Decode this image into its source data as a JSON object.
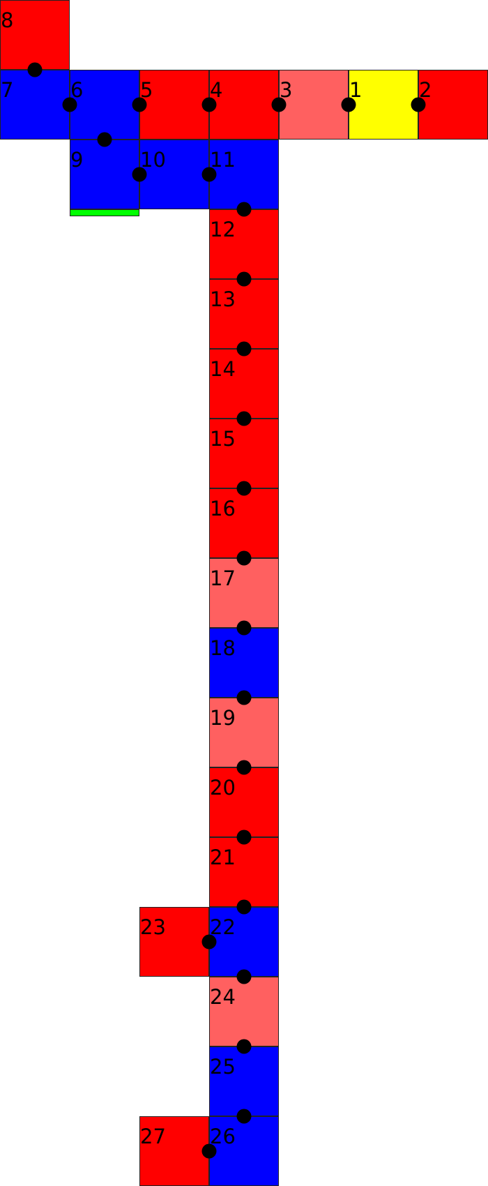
{
  "colors": {
    "red": "#ff0000",
    "salmon": "#ff6060",
    "yellow": "#ffff00",
    "blue": "#0000ff",
    "green": "#00ff00",
    "dot": "#000000",
    "border": "#222222"
  },
  "tiles": [
    {
      "label": "1",
      "color": "yellow"
    },
    {
      "label": "2",
      "color": "red"
    },
    {
      "label": "3",
      "color": "salmon"
    },
    {
      "label": "4",
      "color": "red"
    },
    {
      "label": "5",
      "color": "red"
    },
    {
      "label": "6",
      "color": "blue"
    },
    {
      "label": "7",
      "color": "blue"
    },
    {
      "label": "8",
      "color": "red"
    },
    {
      "label": "9",
      "color": "blue"
    },
    {
      "label": "10",
      "color": "blue"
    },
    {
      "label": "11",
      "color": "blue"
    },
    {
      "label": "12",
      "color": "red"
    },
    {
      "label": "13",
      "color": "red"
    },
    {
      "label": "14",
      "color": "red"
    },
    {
      "label": "15",
      "color": "red"
    },
    {
      "label": "16",
      "color": "red"
    },
    {
      "label": "17",
      "color": "salmon"
    },
    {
      "label": "18",
      "color": "blue"
    },
    {
      "label": "19",
      "color": "salmon"
    },
    {
      "label": "20",
      "color": "red"
    },
    {
      "label": "21",
      "color": "red"
    },
    {
      "label": "22",
      "color": "blue"
    },
    {
      "label": "23",
      "color": "red"
    },
    {
      "label": "24",
      "color": "salmon"
    },
    {
      "label": "25",
      "color": "blue"
    },
    {
      "label": "26",
      "color": "blue"
    },
    {
      "label": "27",
      "color": "red"
    }
  ],
  "connections": [
    [
      "1",
      "2"
    ],
    [
      "1",
      "3"
    ],
    [
      "3",
      "4"
    ],
    [
      "4",
      "5"
    ],
    [
      "5",
      "6"
    ],
    [
      "6",
      "7"
    ],
    [
      "7",
      "8"
    ],
    [
      "6",
      "9"
    ],
    [
      "9",
      "10"
    ],
    [
      "10",
      "11"
    ],
    [
      "11",
      "12"
    ],
    [
      "12",
      "13"
    ],
    [
      "13",
      "14"
    ],
    [
      "14",
      "15"
    ],
    [
      "15",
      "16"
    ],
    [
      "16",
      "17"
    ],
    [
      "17",
      "18"
    ],
    [
      "18",
      "19"
    ],
    [
      "19",
      "20"
    ],
    [
      "20",
      "21"
    ],
    [
      "21",
      "22"
    ],
    [
      "22",
      "23"
    ],
    [
      "22",
      "24"
    ],
    [
      "24",
      "25"
    ],
    [
      "25",
      "26"
    ],
    [
      "26",
      "27"
    ]
  ],
  "marker": {
    "tile": "9",
    "color": "green"
  }
}
